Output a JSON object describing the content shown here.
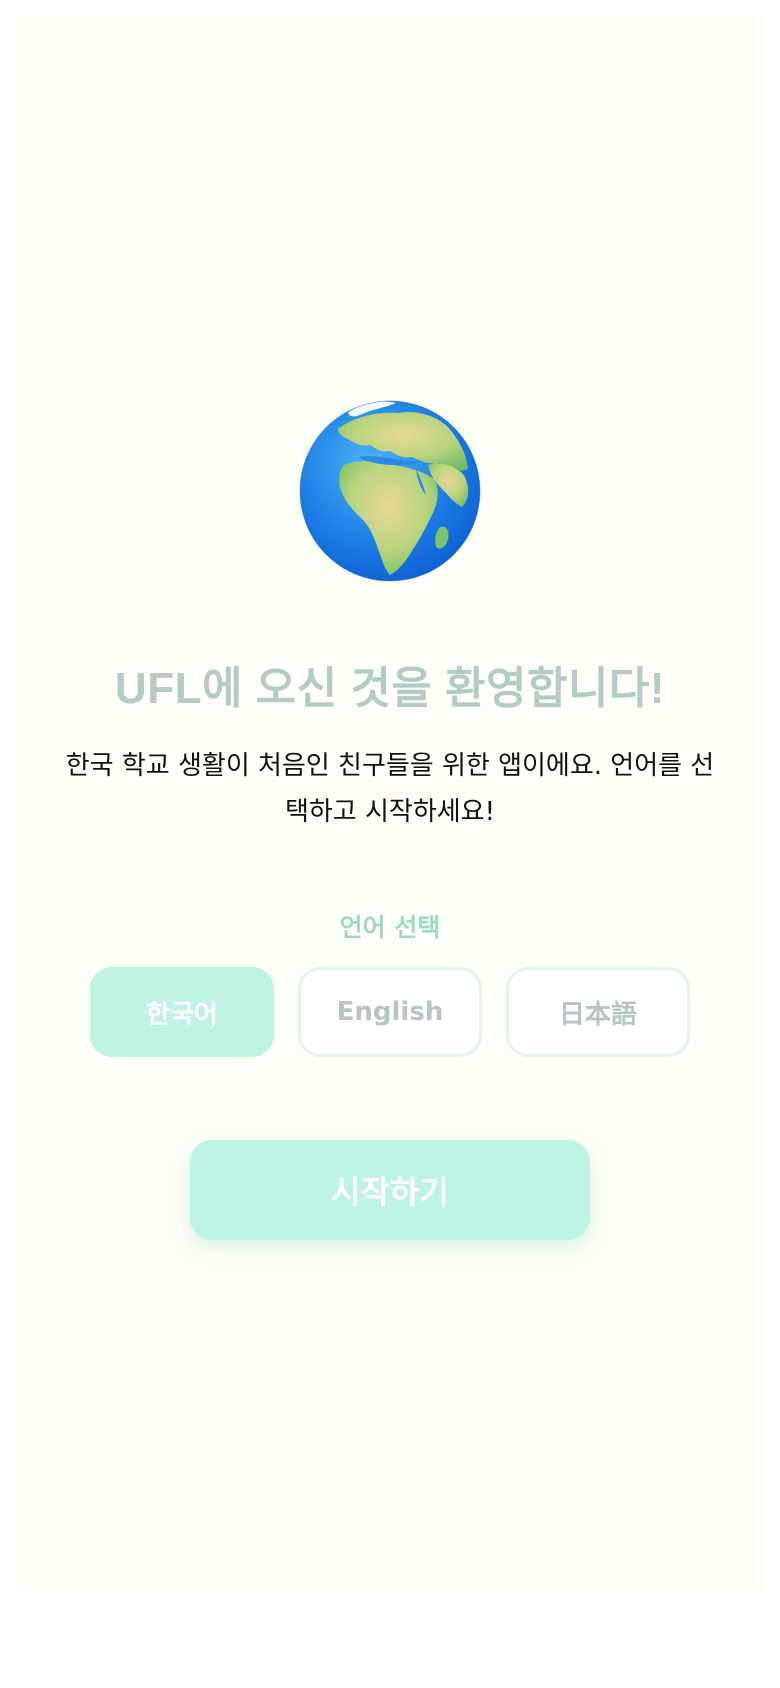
{
  "welcome": {
    "title": "UFL에 오신 것을 환영합니다!",
    "description": "한국 학교 생활이 처음인 친구들을 위한 앱이에요. 언어를 선택하고 시작하세요!"
  },
  "language": {
    "label": "언어 선택",
    "options": [
      {
        "label": "한국어",
        "selected": true
      },
      {
        "label": "English",
        "selected": false
      },
      {
        "label": "日本語",
        "selected": false
      }
    ]
  },
  "start_button": {
    "label": "시작하기"
  },
  "colors": {
    "background": "#fdfef6",
    "title": "#b3cbc6",
    "accent": "#bff2e3",
    "label": "#9fd9c5"
  },
  "icons": {
    "hero": "globe-europe-africa-icon"
  }
}
